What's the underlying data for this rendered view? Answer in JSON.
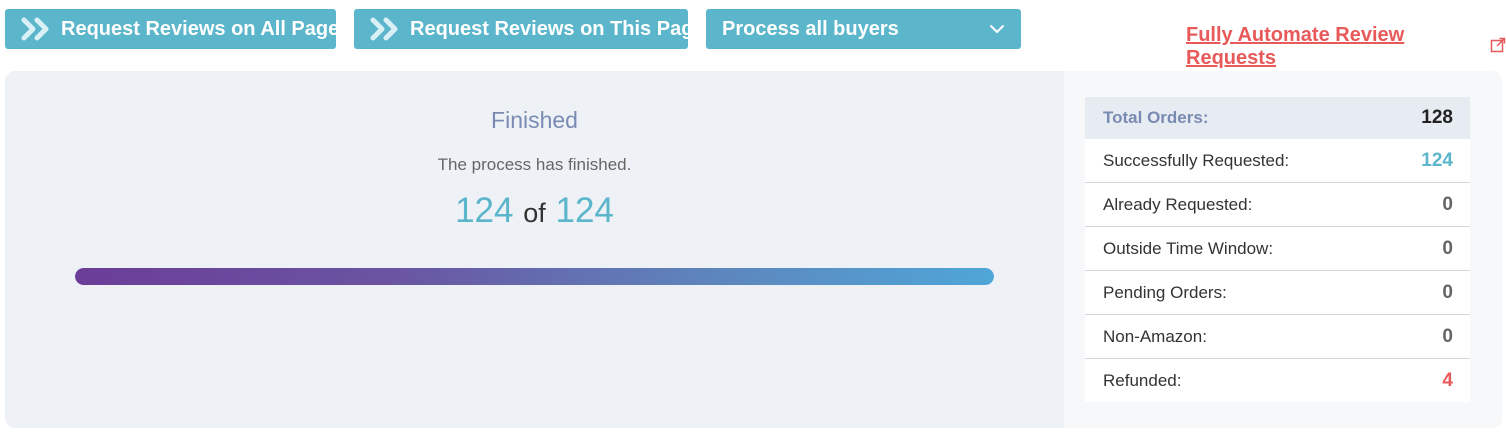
{
  "toolbar": {
    "request_all_label": "Request Reviews on All Pages",
    "request_page_label": "Request Reviews on This Page",
    "buyer_filter_value": "Process all buyers",
    "automate_link": "Fully Automate Review Requests"
  },
  "status": {
    "title": "Finished",
    "message": "The process has finished.",
    "done": "124",
    "of_word": "of",
    "total": "124",
    "progress_fraction": 1.0
  },
  "stats": {
    "rows": [
      {
        "label": "Total Orders:",
        "value": "128",
        "color": "#222222"
      },
      {
        "label": "Successfully Requested:",
        "value": "124",
        "color": "#5bb5cb"
      },
      {
        "label": "Already Requested:",
        "value": "0",
        "color": "#666666"
      },
      {
        "label": "Outside Time Window:",
        "value": "0",
        "color": "#666666"
      },
      {
        "label": "Pending Orders:",
        "value": "0",
        "color": "#666666"
      },
      {
        "label": "Non-Amazon:",
        "value": "0",
        "color": "#666666"
      },
      {
        "label": "Refunded:",
        "value": "4",
        "color": "#e85a5a"
      }
    ]
  },
  "colors": {
    "accent": "#5bb5cb",
    "link": "#e85a5a",
    "panel_bg": "#eef1f6"
  },
  "icons": {
    "button_icon": "double-chevron-right-icon",
    "select_icon": "chevron-down-icon",
    "link_icon": "external-link-icon"
  }
}
